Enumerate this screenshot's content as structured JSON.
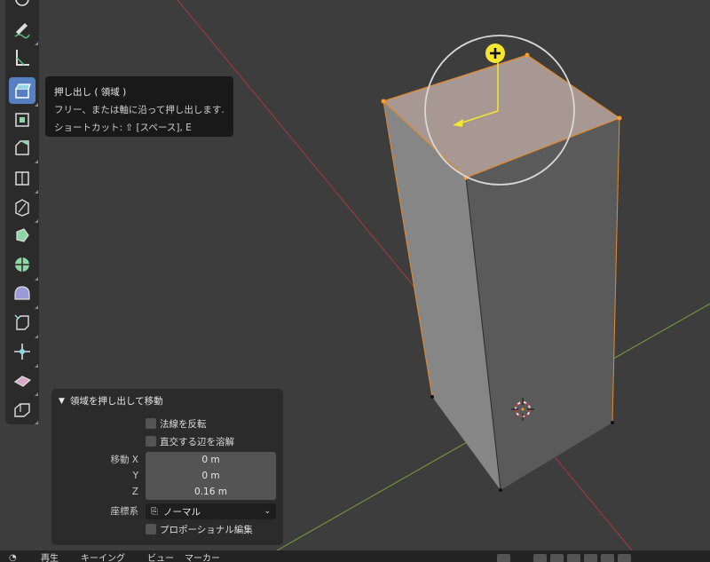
{
  "tooltip": {
    "title": "押し出し ( 領域 )",
    "description": "フリー、または軸に沿って押し出します.",
    "shortcut": "ショートカット: ⇧ [スペース], E"
  },
  "operator_panel": {
    "title": "領域を押し出して移動",
    "flip_normals_label": "法線を反転",
    "dissolve_orthogonal_label": "直交する辺を溶解",
    "move_label": "移動 X",
    "y_label": "Y",
    "z_label": "Z",
    "move_x": "0 m",
    "move_y": "0 m",
    "move_z": "0.16 m",
    "orientation_label": "座標系",
    "orientation_value": "ノーマル",
    "proportional_label": "プロポーショナル編集"
  },
  "footer": {
    "playback": "再生",
    "keying": "キーイング",
    "view": "ビュー",
    "marker": "マーカー"
  },
  "colors": {
    "viewport_bg": "#3d3d3d",
    "active_tool": "#5680c2",
    "gizmo_yellow": "#f5e62f",
    "selection_orange": "#e38a2b",
    "x_axis": "#b23a3a",
    "y_axis": "#7da23a"
  },
  "icons": [
    "annotate-icon",
    "measure-icon",
    "extrude-region-icon",
    "inset-faces-icon",
    "bevel-icon",
    "loop-cut-icon",
    "knife-icon",
    "poly-build-icon",
    "spin-icon",
    "smooth-icon",
    "edge-slide-icon",
    "shrink-fatten-icon",
    "shear-icon",
    "rip-region-icon"
  ]
}
